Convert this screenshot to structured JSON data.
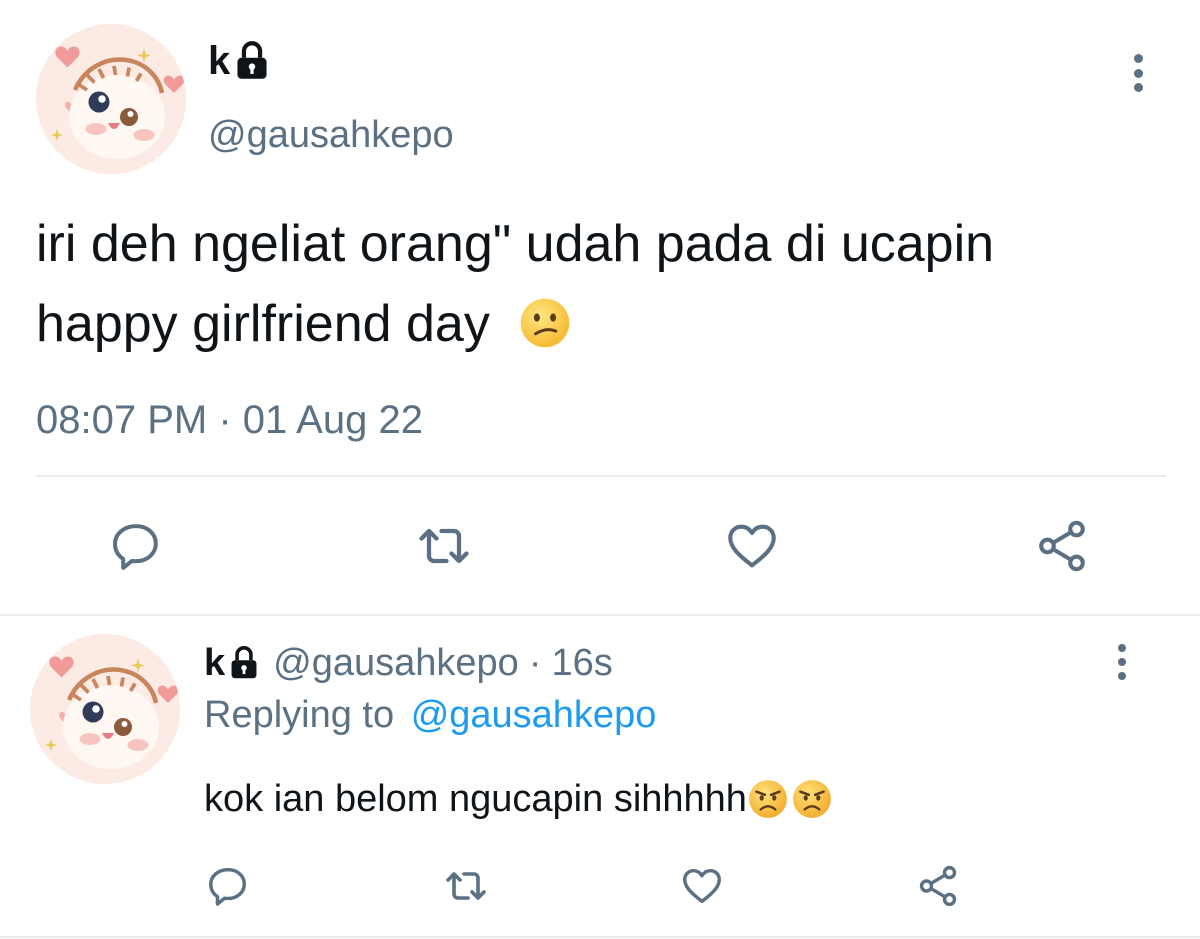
{
  "main_tweet": {
    "display_name": "k",
    "handle": "@gausahkepo",
    "text": "iri deh ngeliat orang\" udah pada di ucapin happy girlfriend day",
    "emoji": "confused-face",
    "timestamp": "08:07 PM · 01 Aug 22",
    "actions": [
      "reply",
      "retweet",
      "like",
      "share"
    ]
  },
  "reply_tweet": {
    "display_name": "k",
    "handle": "@gausahkepo",
    "separator": "·",
    "time_ago": "16s",
    "replying_prefix": "Replying to",
    "replying_handle": "@gausahkepo",
    "text": "kok ian belom ngucapin sihhhhh",
    "emojis": [
      "angry-face",
      "angry-face"
    ],
    "actions": [
      "reply",
      "retweet",
      "like",
      "share"
    ]
  },
  "colors": {
    "text": "#0f1419",
    "secondary": "#5b7083",
    "link": "#1d9bf0",
    "divider": "#e6ecf0",
    "avatar_bg": "#fbe9e2"
  }
}
